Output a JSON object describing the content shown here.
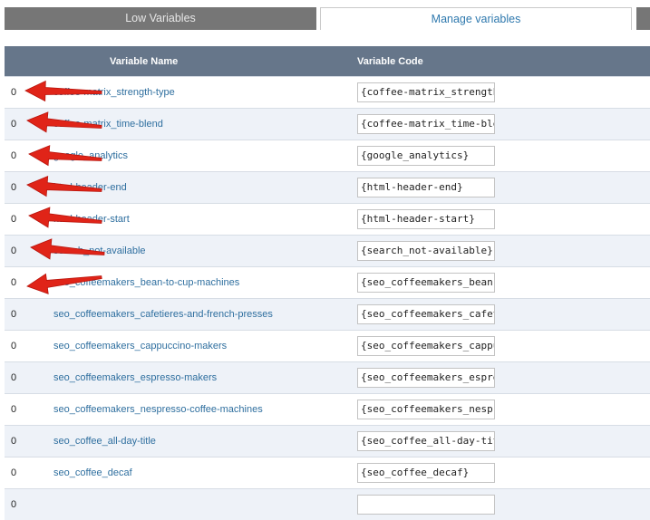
{
  "tabs": {
    "low_variables": "Low Variables",
    "manage_variables": "Manage variables"
  },
  "table": {
    "headers": {
      "name": "Variable Name",
      "code": "Variable Code"
    },
    "rows": [
      {
        "num": "0",
        "name": "coffee-matrix_strength-type",
        "code": "{coffee-matrix_strength-type}"
      },
      {
        "num": "0",
        "name": "coffee-matrix_time-blend",
        "code": "{coffee-matrix_time-blend}"
      },
      {
        "num": "0",
        "name": "google_analytics",
        "code": "{google_analytics}"
      },
      {
        "num": "0",
        "name": "html-header-end",
        "code": "{html-header-end}"
      },
      {
        "num": "0",
        "name": "html-header-start",
        "code": "{html-header-start}"
      },
      {
        "num": "0",
        "name": "search_not-available",
        "code": "{search_not-available}"
      },
      {
        "num": "0",
        "name": "seo_coffeemakers_bean-to-cup-machines",
        "code": "{seo_coffeemakers_bean-to-cup-machines}"
      },
      {
        "num": "0",
        "name": "seo_coffeemakers_cafetieres-and-french-presses",
        "code": "{seo_coffeemakers_cafetieres-and-french-presses}"
      },
      {
        "num": "0",
        "name": "seo_coffeemakers_cappuccino-makers",
        "code": "{seo_coffeemakers_cappuccino-makers}"
      },
      {
        "num": "0",
        "name": "seo_coffeemakers_espresso-makers",
        "code": "{seo_coffeemakers_espresso-makers}"
      },
      {
        "num": "0",
        "name": "seo_coffeemakers_nespresso-coffee-machines",
        "code": "{seo_coffeemakers_nespresso-coffee-machines}"
      },
      {
        "num": "0",
        "name": "seo_coffee_all-day-title",
        "code": "{seo_coffee_all-day-title}"
      },
      {
        "num": "0",
        "name": "seo_coffee_decaf",
        "code": "{seo_coffee_decaf}"
      },
      {
        "num": "0",
        "name": "",
        "code": ""
      }
    ]
  },
  "annotations": {
    "arrow_color": "#e02418"
  }
}
